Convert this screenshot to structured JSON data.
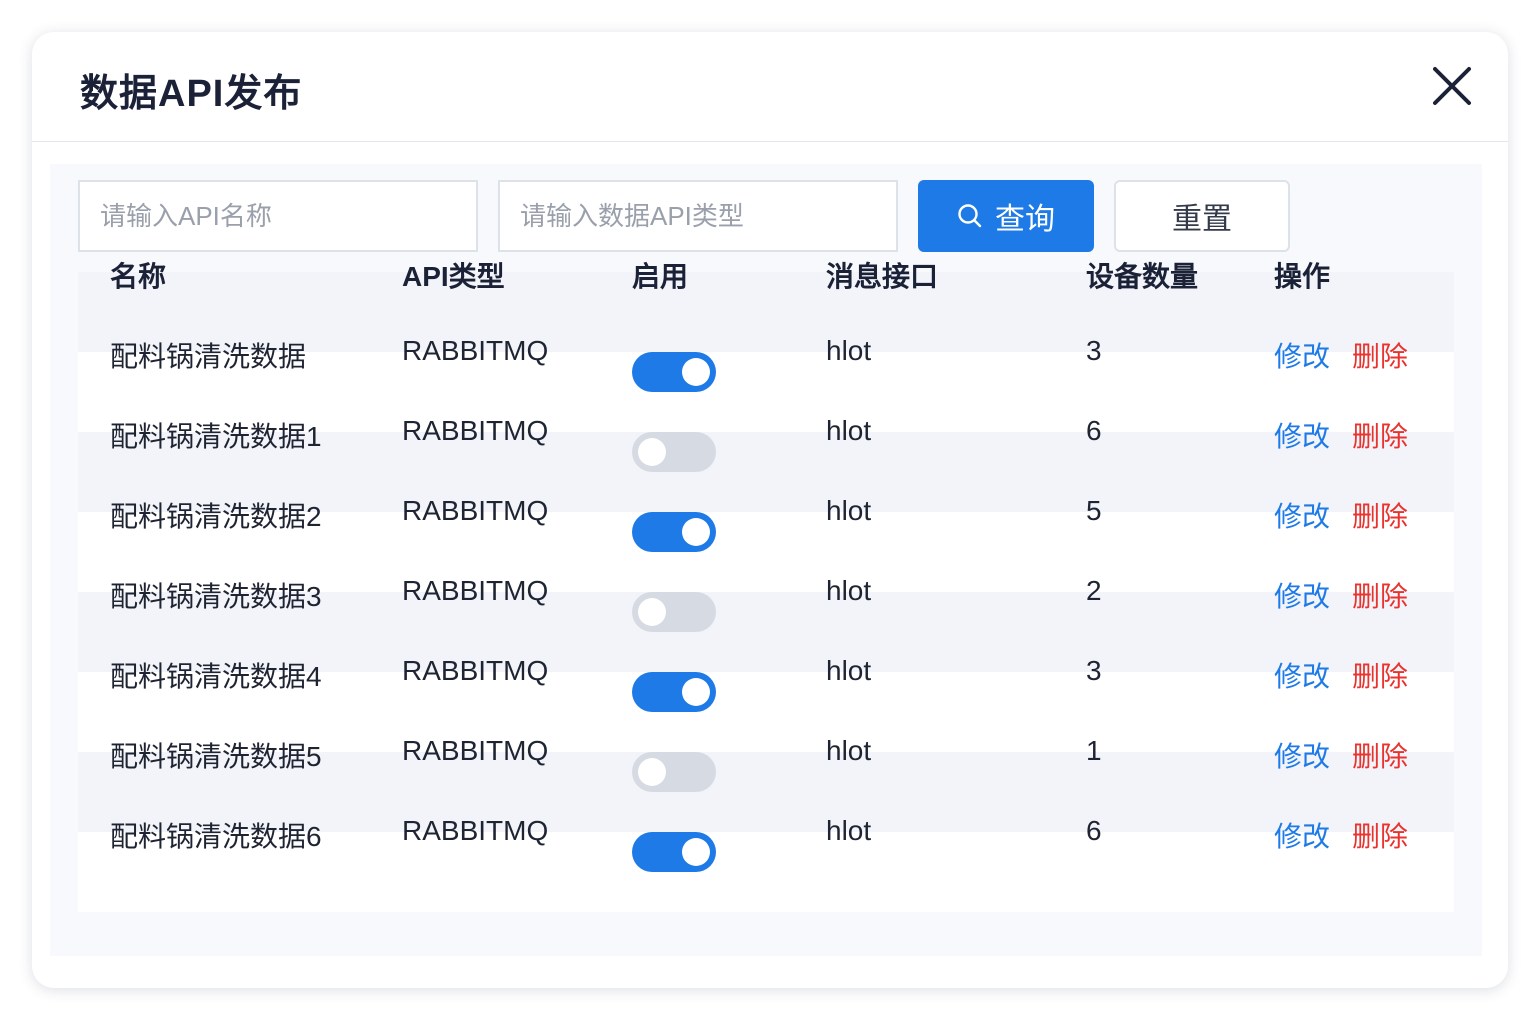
{
  "dialog": {
    "title": "数据API发布"
  },
  "search": {
    "name_placeholder": "请输入API名称",
    "type_placeholder": "请输入数据API类型",
    "query_label": "查询",
    "reset_label": "重置"
  },
  "table": {
    "columns": [
      "名称",
      "API类型",
      "启用",
      "消息接口",
      "设备数量",
      "操作"
    ],
    "rows": [
      {
        "name": "配料锅清洗数据",
        "api_type": "RABBITMQ",
        "enabled": true,
        "interface": "hlot",
        "device_count": "3",
        "edit": "修改",
        "delete": "删除"
      },
      {
        "name": "配料锅清洗数据1",
        "api_type": "RABBITMQ",
        "enabled": false,
        "interface": "hlot",
        "device_count": "6",
        "edit": "修改",
        "delete": "删除"
      },
      {
        "name": "配料锅清洗数据2",
        "api_type": "RABBITMQ",
        "enabled": true,
        "interface": "hlot",
        "device_count": "5",
        "edit": "修改",
        "delete": "删除"
      },
      {
        "name": "配料锅清洗数据3",
        "api_type": "RABBITMQ",
        "enabled": false,
        "interface": "hlot",
        "device_count": "2",
        "edit": "修改",
        "delete": "删除"
      },
      {
        "name": "配料锅清洗数据4",
        "api_type": "RABBITMQ",
        "enabled": true,
        "interface": "hlot",
        "device_count": "3",
        "edit": "修改",
        "delete": "删除"
      },
      {
        "name": "配料锅清洗数据5",
        "api_type": "RABBITMQ",
        "enabled": false,
        "interface": "hlot",
        "device_count": "1",
        "edit": "修改",
        "delete": "删除"
      },
      {
        "name": "配料锅清洗数据6",
        "api_type": "RABBITMQ",
        "enabled": true,
        "interface": "hlot",
        "device_count": "6",
        "edit": "修改",
        "delete": "删除"
      }
    ]
  },
  "colors": {
    "primary": "#1d7ae6",
    "danger": "#e8332e",
    "toggle_off": "#d6dae2"
  },
  "icons": {
    "close": "close-icon",
    "search": "search-icon"
  }
}
